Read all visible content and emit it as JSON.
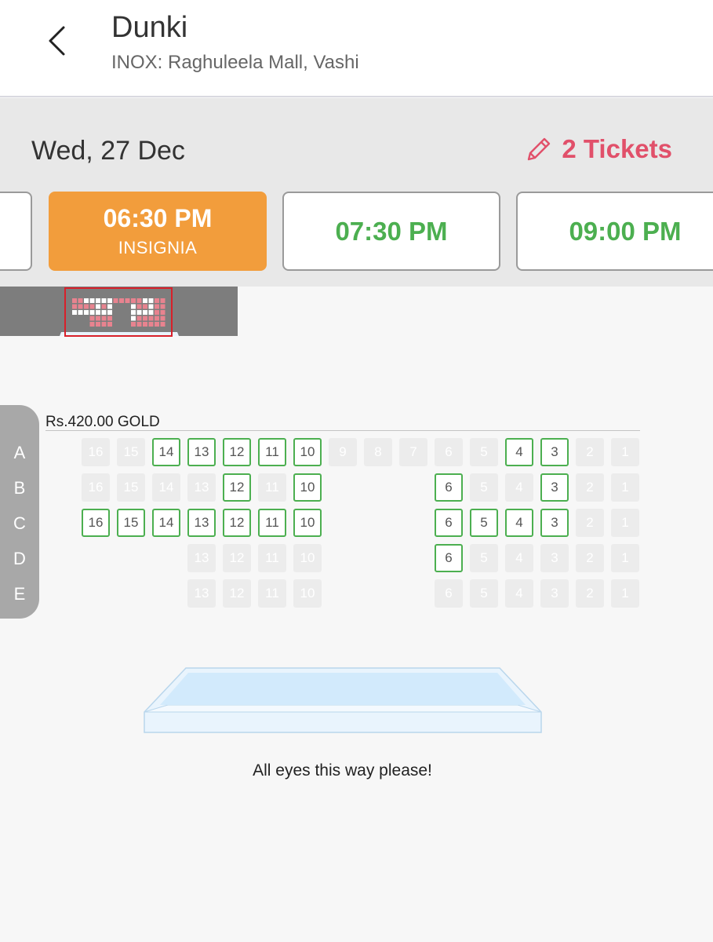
{
  "header": {
    "back_icon": "chevron-left-icon",
    "title": "Dunki",
    "subtitle": "INOX: Raghuleela Mall, Vashi"
  },
  "datebar": {
    "date": "Wed, 27 Dec",
    "tickets_icon": "pencil-icon",
    "tickets_label": "2 Tickets",
    "tickets_color": "#e1506a"
  },
  "showtimes": [
    {
      "time": "",
      "format": "",
      "selected": false
    },
    {
      "time": "06:30 PM",
      "format": "INSIGNIA",
      "selected": true
    },
    {
      "time": "07:30 PM",
      "format": "",
      "selected": false
    },
    {
      "time": "09:00 PM",
      "format": "",
      "selected": false
    }
  ],
  "colors": {
    "accent_orange": "#f29d3c",
    "available_green": "#4caf50",
    "sold_grey": "#ececec"
  },
  "seat_layout": {
    "price_label": "Rs.420.00  GOLD",
    "rows": [
      {
        "label": "A",
        "seats": [
          {
            "n": "16",
            "s": "sold"
          },
          {
            "n": "15",
            "s": "sold"
          },
          {
            "n": "14",
            "s": "available"
          },
          {
            "n": "13",
            "s": "available"
          },
          {
            "n": "12",
            "s": "available"
          },
          {
            "n": "11",
            "s": "available"
          },
          {
            "n": "10",
            "s": "available"
          },
          {
            "n": "9",
            "s": "sold"
          },
          {
            "n": "8",
            "s": "sold"
          },
          {
            "n": "7",
            "s": "sold"
          },
          {
            "n": "6",
            "s": "sold"
          },
          {
            "n": "5",
            "s": "sold"
          },
          {
            "n": "4",
            "s": "available"
          },
          {
            "n": "3",
            "s": "available"
          },
          {
            "n": "2",
            "s": "sold"
          },
          {
            "n": "1",
            "s": "sold"
          }
        ]
      },
      {
        "label": "B",
        "seats": [
          {
            "n": "16",
            "s": "sold"
          },
          {
            "n": "15",
            "s": "sold"
          },
          {
            "n": "14",
            "s": "sold"
          },
          {
            "n": "13",
            "s": "sold"
          },
          {
            "n": "12",
            "s": "available"
          },
          {
            "n": "11",
            "s": "sold"
          },
          {
            "n": "10",
            "s": "available"
          },
          null,
          null,
          null,
          {
            "n": "6",
            "s": "available"
          },
          {
            "n": "5",
            "s": "sold"
          },
          {
            "n": "4",
            "s": "sold"
          },
          {
            "n": "3",
            "s": "available"
          },
          {
            "n": "2",
            "s": "sold"
          },
          {
            "n": "1",
            "s": "sold"
          }
        ]
      },
      {
        "label": "C",
        "seats": [
          {
            "n": "16",
            "s": "available"
          },
          {
            "n": "15",
            "s": "available"
          },
          {
            "n": "14",
            "s": "available"
          },
          {
            "n": "13",
            "s": "available"
          },
          {
            "n": "12",
            "s": "available"
          },
          {
            "n": "11",
            "s": "available"
          },
          {
            "n": "10",
            "s": "available"
          },
          null,
          null,
          null,
          {
            "n": "6",
            "s": "available"
          },
          {
            "n": "5",
            "s": "available"
          },
          {
            "n": "4",
            "s": "available"
          },
          {
            "n": "3",
            "s": "available"
          },
          {
            "n": "2",
            "s": "sold"
          },
          {
            "n": "1",
            "s": "sold"
          }
        ]
      },
      {
        "label": "D",
        "seats": [
          null,
          null,
          null,
          {
            "n": "13",
            "s": "sold"
          },
          {
            "n": "12",
            "s": "sold"
          },
          {
            "n": "11",
            "s": "sold"
          },
          {
            "n": "10",
            "s": "sold"
          },
          null,
          null,
          null,
          {
            "n": "6",
            "s": "available"
          },
          {
            "n": "5",
            "s": "sold"
          },
          {
            "n": "4",
            "s": "sold"
          },
          {
            "n": "3",
            "s": "sold"
          },
          {
            "n": "2",
            "s": "sold"
          },
          {
            "n": "1",
            "s": "sold"
          }
        ]
      },
      {
        "label": "E",
        "seats": [
          null,
          null,
          null,
          {
            "n": "13",
            "s": "sold"
          },
          {
            "n": "12",
            "s": "sold"
          },
          {
            "n": "11",
            "s": "sold"
          },
          {
            "n": "10",
            "s": "sold"
          },
          null,
          null,
          null,
          {
            "n": "6",
            "s": "sold"
          },
          {
            "n": "5",
            "s": "sold"
          },
          {
            "n": "4",
            "s": "sold"
          },
          {
            "n": "3",
            "s": "sold"
          },
          {
            "n": "2",
            "s": "sold"
          },
          {
            "n": "1",
            "s": "sold"
          }
        ]
      }
    ]
  },
  "screen": {
    "caption": "All eyes this way please!"
  }
}
